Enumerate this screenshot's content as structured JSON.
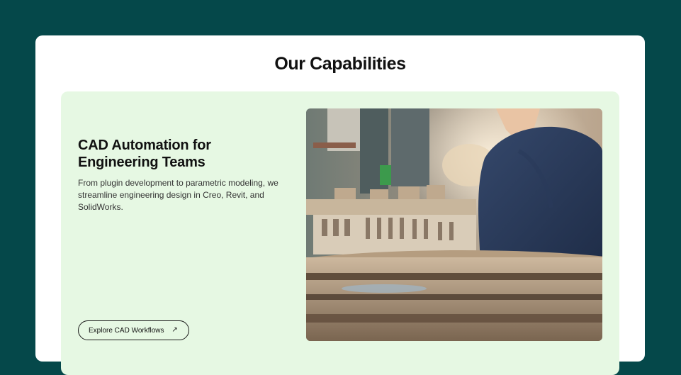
{
  "section": {
    "title": "Our Capabilities"
  },
  "capability": {
    "heading": "CAD Automation for Engineering Teams",
    "description": "From plugin development to parametric modeling, we streamline engineering design in Creo, Revit, and SolidWorks.",
    "cta_label": "Explore CAD Workflows",
    "cta_icon": "arrow-up-right-icon"
  },
  "colors": {
    "page_background": "#05484a",
    "card_background": "#ffffff",
    "panel_background": "#e6f8e3",
    "text_primary": "#111111"
  }
}
